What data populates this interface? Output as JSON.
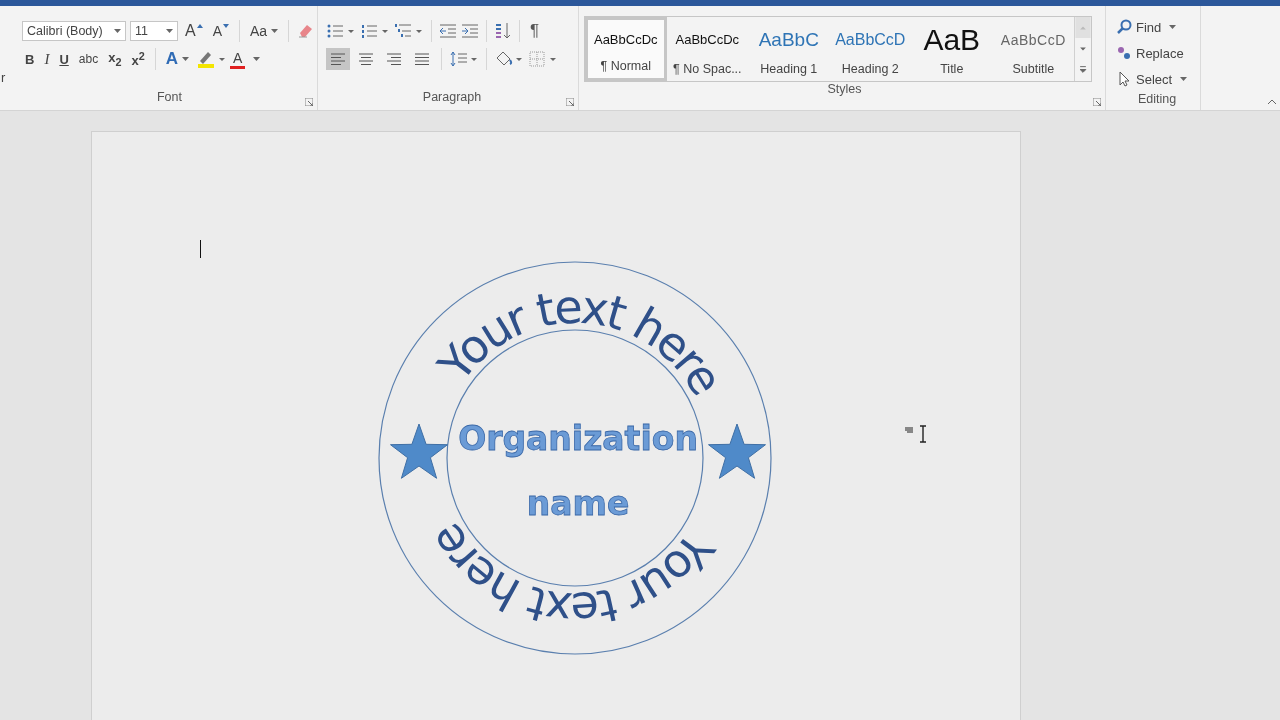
{
  "ribbon": {
    "left_edge_text": "r",
    "font": {
      "label": "Font",
      "font_name": "Calibri (Body)",
      "font_size": "11",
      "grow_font": "A",
      "shrink_font": "A",
      "change_case": "Aa",
      "format_buttons": [
        {
          "label": "B",
          "kind": "bold"
        },
        {
          "label": "I",
          "kind": "italic"
        },
        {
          "label": "U",
          "kind": "underline"
        },
        {
          "label": "abc",
          "kind": "strike"
        },
        {
          "label": "x$_{2}$",
          "kind": "script"
        },
        {
          "label": "x$^{2}$",
          "kind": "script"
        }
      ],
      "text_effects": "A",
      "font_color": "A"
    },
    "paragraph": {
      "label": "Paragraph",
      "pilcrow": "¶",
      "alignment": [
        {
          "kind": "left",
          "selected": true
        },
        {
          "kind": "center",
          "selected": false
        },
        {
          "kind": "right",
          "selected": false
        },
        {
          "kind": "justify",
          "selected": false
        }
      ]
    },
    "styles": {
      "label": "Styles",
      "items": [
        {
          "preview": "AaBbCcDc",
          "label": "¶ Normal",
          "kind": "normal",
          "selected": true
        },
        {
          "preview": "AaBbCcDc",
          "label": "¶ No Spac...",
          "kind": "nospace",
          "selected": false
        },
        {
          "preview": "AaBbC",
          "label": "Heading 1",
          "kind": "heading1",
          "selected": false
        },
        {
          "preview": "AaBbCcD",
          "label": "Heading 2",
          "kind": "heading2",
          "selected": false
        },
        {
          "preview": "AaB",
          "label": "Title",
          "kind": "title",
          "selected": false
        },
        {
          "preview": "AaBbCcD",
          "label": "Subtitle",
          "kind": "subtitle",
          "selected": false
        }
      ]
    },
    "editing": {
      "label": "Editing",
      "items": [
        {
          "label": "Find",
          "kind": "find"
        },
        {
          "label": "Replace",
          "kind": "replace"
        },
        {
          "label": "Select",
          "kind": "select"
        }
      ]
    }
  },
  "document": {
    "stamp": {
      "arc_top": "Your text here",
      "arc_bottom": "Your text here",
      "center_lines": [
        "Organization",
        "name"
      ]
    }
  }
}
